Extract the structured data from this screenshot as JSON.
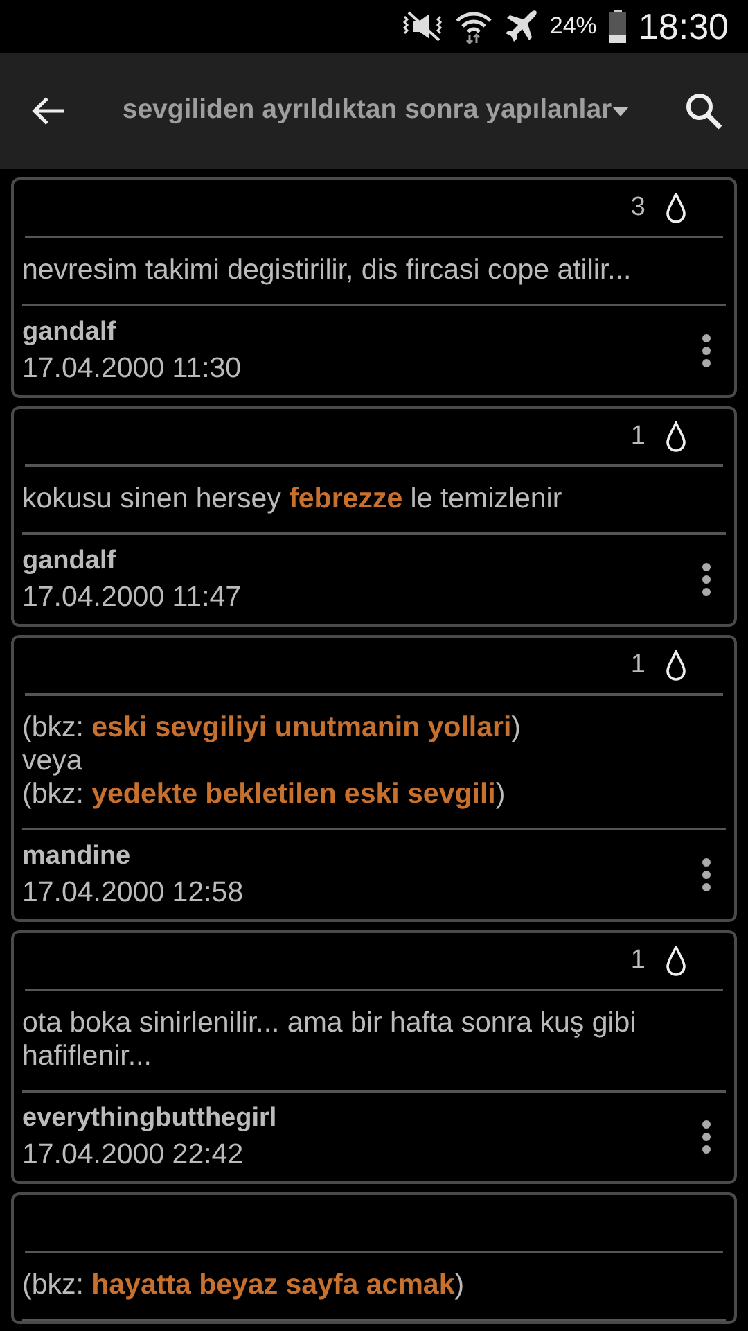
{
  "status_bar": {
    "battery": "24%",
    "time": "18:30"
  },
  "toolbar": {
    "title": "sevgiliden ayrıldıktan sonra yapılanlar"
  },
  "entries": [
    {
      "count": "3",
      "body": [
        [
          {
            "text": "nevresim takimi degistirilir, dis fircasi cope atilir...",
            "link": false
          }
        ]
      ],
      "author": "gandalf",
      "date": "17.04.2000 11:30"
    },
    {
      "count": "1",
      "body": [
        [
          {
            "text": "kokusu sinen hersey ",
            "link": false
          },
          {
            "text": "febrezze",
            "link": true
          },
          {
            "text": " le temizlenir",
            "link": false
          }
        ]
      ],
      "author": "gandalf",
      "date": "17.04.2000 11:47"
    },
    {
      "count": "1",
      "body": [
        [
          {
            "text": "(bkz: ",
            "link": false
          },
          {
            "text": "eski sevgiliyi unutmanin yollari",
            "link": true
          },
          {
            "text": ")",
            "link": false
          }
        ],
        [
          {
            "text": "veya",
            "link": false
          }
        ],
        [
          {
            "text": "(bkz: ",
            "link": false
          },
          {
            "text": "yedekte bekletilen eski sevgili",
            "link": true
          },
          {
            "text": ")",
            "link": false
          }
        ]
      ],
      "author": "mandine",
      "date": "17.04.2000 12:58"
    },
    {
      "count": "1",
      "body": [
        [
          {
            "text": "ota boka sinirlenilir... ama bir hafta sonra kuş gibi hafiflenir...",
            "link": false
          }
        ]
      ],
      "author": "everythingbutthegirl",
      "date": "17.04.2000 22:42"
    },
    {
      "body": [
        [
          {
            "text": "(bkz: ",
            "link": false
          },
          {
            "text": "hayatta beyaz sayfa acmak",
            "link": true
          },
          {
            "text": ")",
            "link": false
          }
        ]
      ]
    }
  ]
}
